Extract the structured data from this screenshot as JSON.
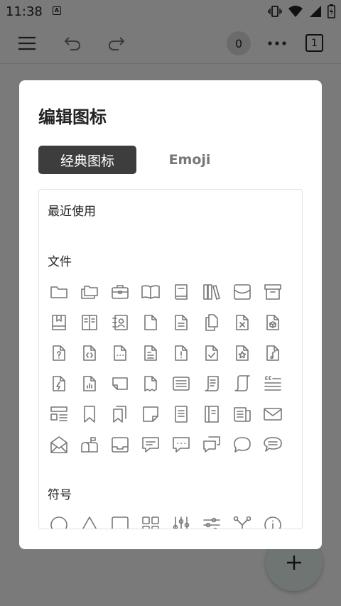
{
  "status_bar": {
    "time": "11:38",
    "notification_letter": "A",
    "icons": [
      "vibrate-icon",
      "wifi-icon",
      "signal-icon",
      "battery-icon"
    ]
  },
  "toolbar": {
    "menu_icon": "hamburger-menu-icon",
    "undo_icon": "undo-icon",
    "redo_icon": "redo-icon",
    "counter": "0",
    "more_icon": "more-icon",
    "page_count": "1"
  },
  "dialog": {
    "title": "编辑图标",
    "tabs": [
      {
        "label": "经典图标",
        "active": true
      },
      {
        "label": "Emoji",
        "active": false
      }
    ],
    "sections": {
      "recent": {
        "label": "最近使用"
      },
      "files": {
        "label": "文件",
        "icons": [
          "folder-icon",
          "folders-icon",
          "briefcase-icon",
          "book-open-icon",
          "book-icon",
          "bookshelf-icon",
          "inbox-tray-icon",
          "archive-box-icon",
          "bookmark-book-icon",
          "notebook-icon",
          "contact-book-icon",
          "file-icon",
          "file-text-icon",
          "files-copy-icon",
          "file-x-icon",
          "file-cube-icon",
          "file-question-icon",
          "file-code-icon",
          "file-dots-icon",
          "file-list-icon",
          "file-alert-icon",
          "file-check-icon",
          "file-star-icon",
          "file-music-icon",
          "file-lightning-icon",
          "file-chart-icon",
          "file-folded-icon",
          "file-torn-icon",
          "document-lines-icon",
          "scroll-icon",
          "scroll-open-icon",
          "quote-lines-icon",
          "layout-list-icon",
          "bookmark-icon",
          "bookmarks-icon",
          "sticky-note-icon",
          "note-lines-icon",
          "ledger-icon",
          "newspaper-icon",
          "mail-icon",
          "mail-open-icon",
          "mailbox-icon",
          "tray-icon",
          "chat-lines-icon",
          "chat-dots-icon",
          "chat-double-icon",
          "chat-bubble-icon",
          "chat-oval-lines-icon"
        ]
      },
      "symbols": {
        "label": "符号",
        "icons": [
          "circle-icon",
          "triangle-icon",
          "square-icon",
          "grid-icon",
          "sliders-vertical-icon",
          "sliders-horizontal-icon",
          "branch-icon",
          "info-icon"
        ]
      }
    }
  },
  "fab": {
    "icon": "plus-icon"
  }
}
